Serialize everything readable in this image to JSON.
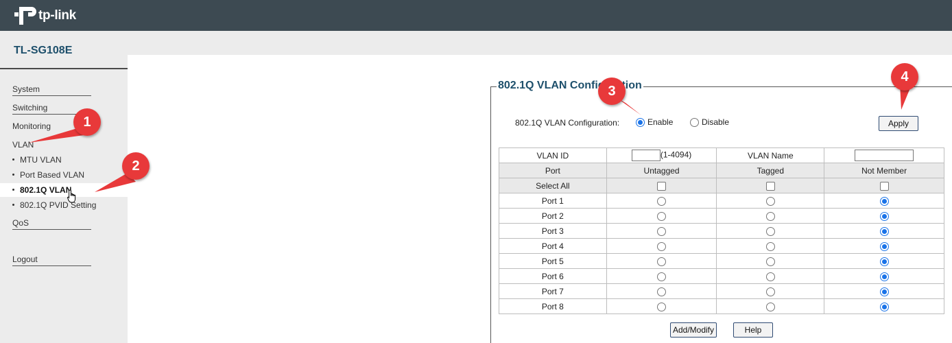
{
  "header": {
    "brand": "tp-link",
    "model": "TL-SG108E"
  },
  "sidebar": {
    "items": [
      {
        "label": "System"
      },
      {
        "label": "Switching"
      },
      {
        "label": "Monitoring"
      },
      {
        "label": "VLAN"
      }
    ],
    "vlan_sub": [
      {
        "label": "MTU VLAN"
      },
      {
        "label": "Port Based VLAN"
      },
      {
        "label": "802.1Q VLAN",
        "active": true
      },
      {
        "label": "802.1Q PVID Setting"
      }
    ],
    "after": [
      {
        "label": "QoS"
      }
    ],
    "logout": "Logout"
  },
  "config": {
    "legend": "802.1Q VLAN Configuration",
    "label": "802.1Q VLAN Configuration:",
    "enable_label": "Enable",
    "disable_label": "Disable",
    "selected": "Enable",
    "apply_label": "Apply"
  },
  "table": {
    "vlan_id_label": "VLAN ID",
    "vlan_id_value": "",
    "vlan_id_range": "(1-4094)",
    "vlan_name_label": "VLAN Name",
    "vlan_name_value": "",
    "headers": [
      "Port",
      "Untagged",
      "Tagged",
      "Not Member"
    ],
    "select_all_label": "Select All",
    "ports": [
      {
        "name": "Port 1",
        "membership": "Not Member"
      },
      {
        "name": "Port 2",
        "membership": "Not Member"
      },
      {
        "name": "Port 3",
        "membership": "Not Member"
      },
      {
        "name": "Port 4",
        "membership": "Not Member"
      },
      {
        "name": "Port 5",
        "membership": "Not Member"
      },
      {
        "name": "Port 6",
        "membership": "Not Member"
      },
      {
        "name": "Port 7",
        "membership": "Not Member"
      },
      {
        "name": "Port 8",
        "membership": "Not Member"
      }
    ]
  },
  "buttons": {
    "add_modify": "Add/Modify",
    "help": "Help"
  },
  "callouts": [
    "1",
    "2",
    "3",
    "4"
  ],
  "colors": {
    "header_bg": "#3d4a52",
    "title": "#1d4f6b",
    "callout": "#e8393a",
    "radio_on": "#1a73e8"
  }
}
